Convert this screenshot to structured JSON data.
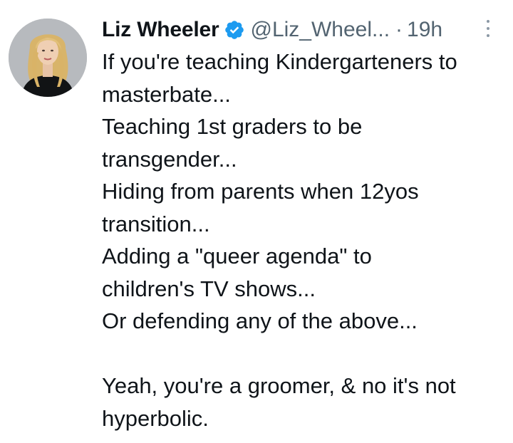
{
  "tweet": {
    "author": {
      "name": "Liz Wheeler",
      "handle": "@Liz_Wheel...",
      "separator": "·",
      "time": "19h"
    },
    "colors": {
      "verified_badge": "#1d9bf0",
      "secondary_text": "#536471",
      "primary_text": "#0f1419"
    },
    "icons": {
      "verified": "verified-badge-icon",
      "more": "more-vertical-icon"
    },
    "lines": [
      "If you're teaching Kindergarteners to",
      "masterbate...",
      "Teaching 1st graders to be",
      "transgender...",
      "Hiding from parents when 12yos",
      "transition...",
      "Adding a \"queer agenda\" to",
      "children's TV shows...",
      "Or defending any of the above..."
    ],
    "closing_lines": [
      "Yeah, you're a groomer, & no it's not",
      "hyperbolic."
    ]
  }
}
